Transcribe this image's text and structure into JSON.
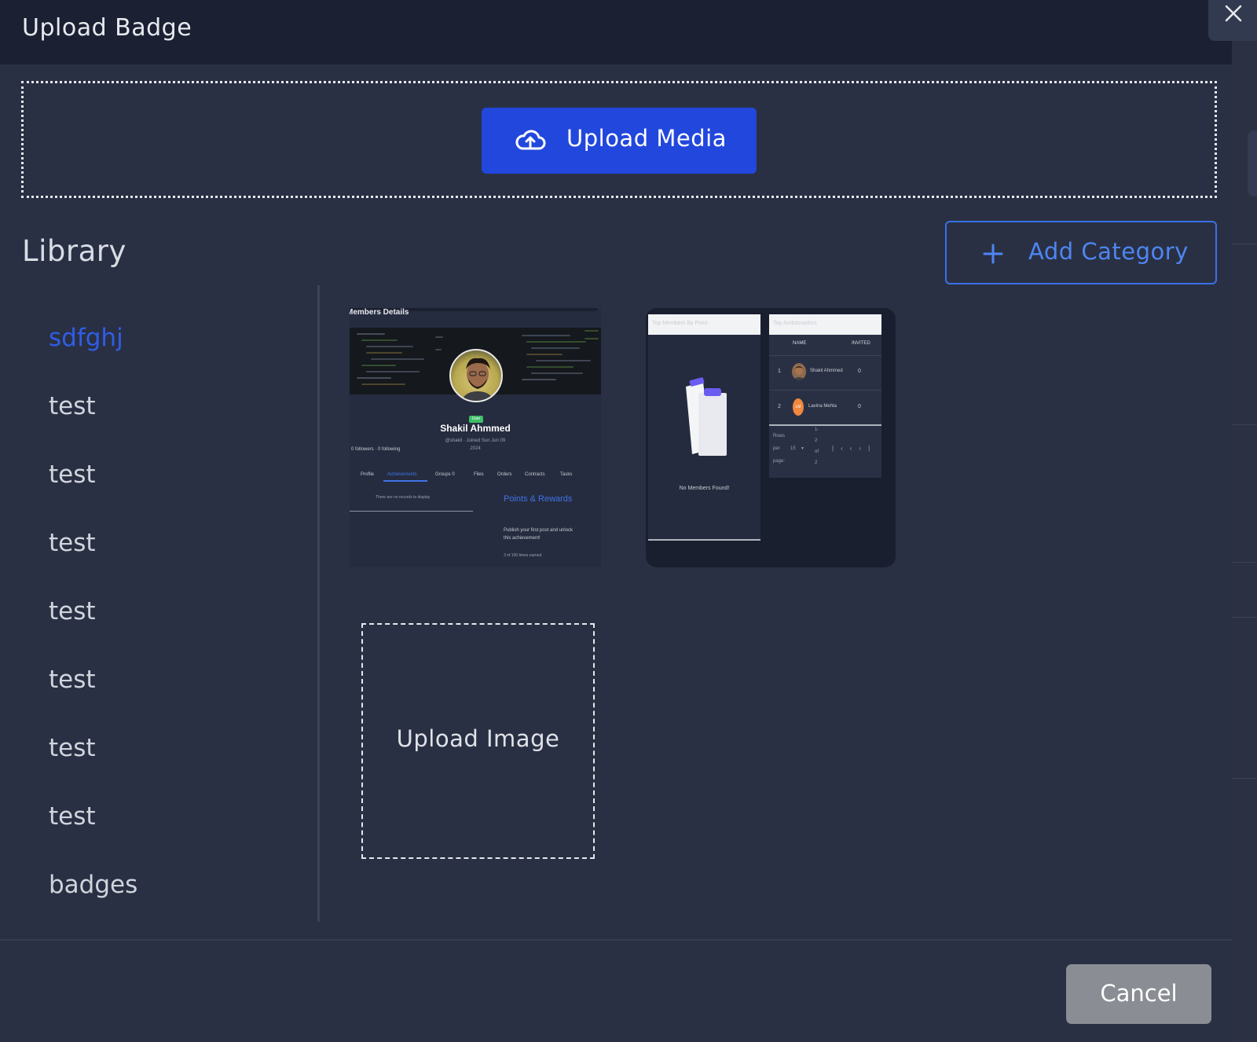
{
  "header": {
    "title": "Upload Badge"
  },
  "dropzone": {
    "button_label": "Upload Media"
  },
  "library": {
    "title": "Library",
    "add_category_label": "Add Category",
    "categories": [
      {
        "label": "sdfghj",
        "active": true
      },
      {
        "label": "test"
      },
      {
        "label": "test"
      },
      {
        "label": "test"
      },
      {
        "label": "test"
      },
      {
        "label": "test"
      },
      {
        "label": "test"
      },
      {
        "label": "test"
      },
      {
        "label": "badges"
      }
    ]
  },
  "thumbnails": {
    "member": {
      "heading": "Members Details",
      "badge": "User",
      "name": "Shakil Ahmmed",
      "handle": "@shakil · Joined Sun Jun 09",
      "year": "2024",
      "follow": "0 followers · 0 following",
      "tabs": [
        "Profile",
        "Achievements",
        "Groups 0",
        "Files",
        "Orders",
        "Contracts",
        "Tasks"
      ],
      "empty_text": "There are no records to display",
      "rewards_title": "Points & Rewards",
      "rewards_desc_1": "Publish your first post and unlock",
      "rewards_desc_2": "this achievement!",
      "rewards_count": "3 of 100 times earned"
    },
    "leaderboard": {
      "left_title": "Top Members By Point",
      "right_title": "Top Ambassadors",
      "empty_text": "No Members Found!",
      "col_name": "NAME",
      "col_invited": "INVITED",
      "rows": [
        {
          "rank": "1",
          "name": "Shakil Ahmmed",
          "invited": "0"
        },
        {
          "rank": "2",
          "name": "Lavina Mehta",
          "invited": "0",
          "initials": "LM"
        }
      ],
      "rows_per_page_1": "Rows",
      "rows_per_page_2": "per",
      "rows_per_page_3": "page:",
      "rows_per_page_value": "15",
      "range_1": "1-",
      "range_2": "2",
      "range_3": "of",
      "range_4": "2"
    }
  },
  "upload_image": {
    "label": "Upload Image"
  },
  "footer": {
    "cancel_label": "Cancel"
  },
  "colors": {
    "primary": "#2147dd",
    "accent_link": "#4d86f3",
    "active_category": "#2f5de6",
    "header_bg": "#1b2133",
    "modal_bg": "#2a3043"
  }
}
